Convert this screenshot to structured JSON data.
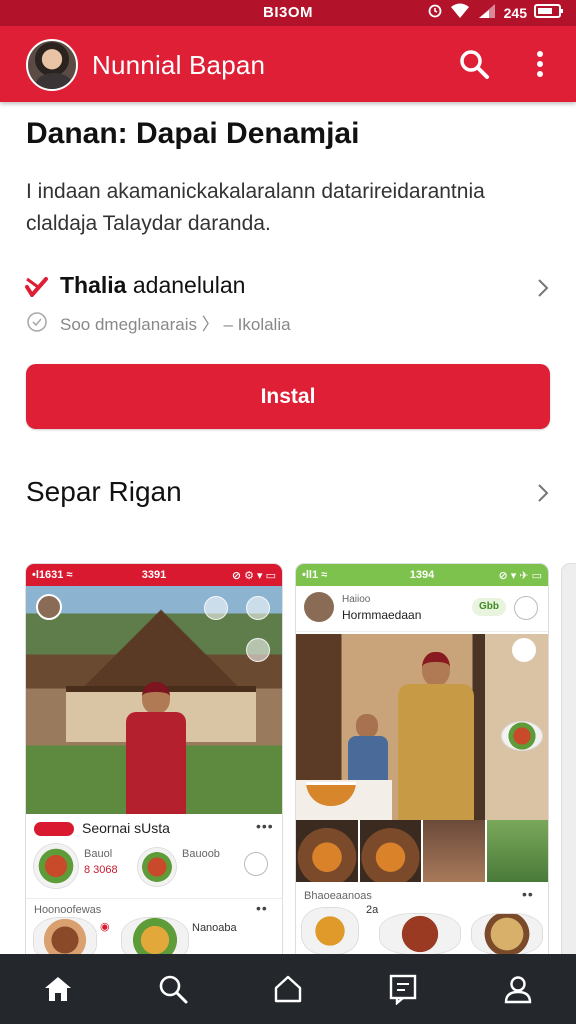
{
  "status_bar": {
    "time": "BI3OM",
    "battery": "245"
  },
  "app_bar": {
    "title": "Nunnial Bapan"
  },
  "app": {
    "heading": "Danan: Dapai Denamjai",
    "description": "I indaan akamanickakalaralann datarireidarantnia claldaja Talaydar daranda.",
    "info_title_bold": "Thalia",
    "info_title_rest": " adanelulan",
    "info_subtitle": "Soo dmeglanarais 〉 – Ikolalia",
    "install_label": "Instal"
  },
  "section": {
    "title": "Separ Rigan"
  },
  "screenshots": {
    "card1": {
      "time": "3391",
      "signal": "•l1631 ≈",
      "icons": "⊘ ⚙ ▾ ▭",
      "name": "Seornai sUsta",
      "label_a": "Bauol",
      "price_a": "8 3068",
      "label_b": "Bauoob",
      "section2": "Hoonoofewas",
      "item_a": "Nanoaba"
    },
    "card2": {
      "time": "1394",
      "signal": "•ll1 ≈",
      "icons": "⊘ ▾ ✈ ▭",
      "user_small": "Haiioo",
      "user_name": "Hormmaedaan",
      "badge": "Gbb",
      "section2": "Bhaoeaanoas",
      "num": "2a"
    }
  },
  "colors": {
    "primary": "#de1f36",
    "status": "#b3122b",
    "nav": "#24282d",
    "green": "#7cc24c"
  },
  "bottom_nav": {
    "items": [
      "home-icon",
      "search-icon",
      "home-outline-icon",
      "inbox-icon",
      "profile-icon"
    ]
  }
}
